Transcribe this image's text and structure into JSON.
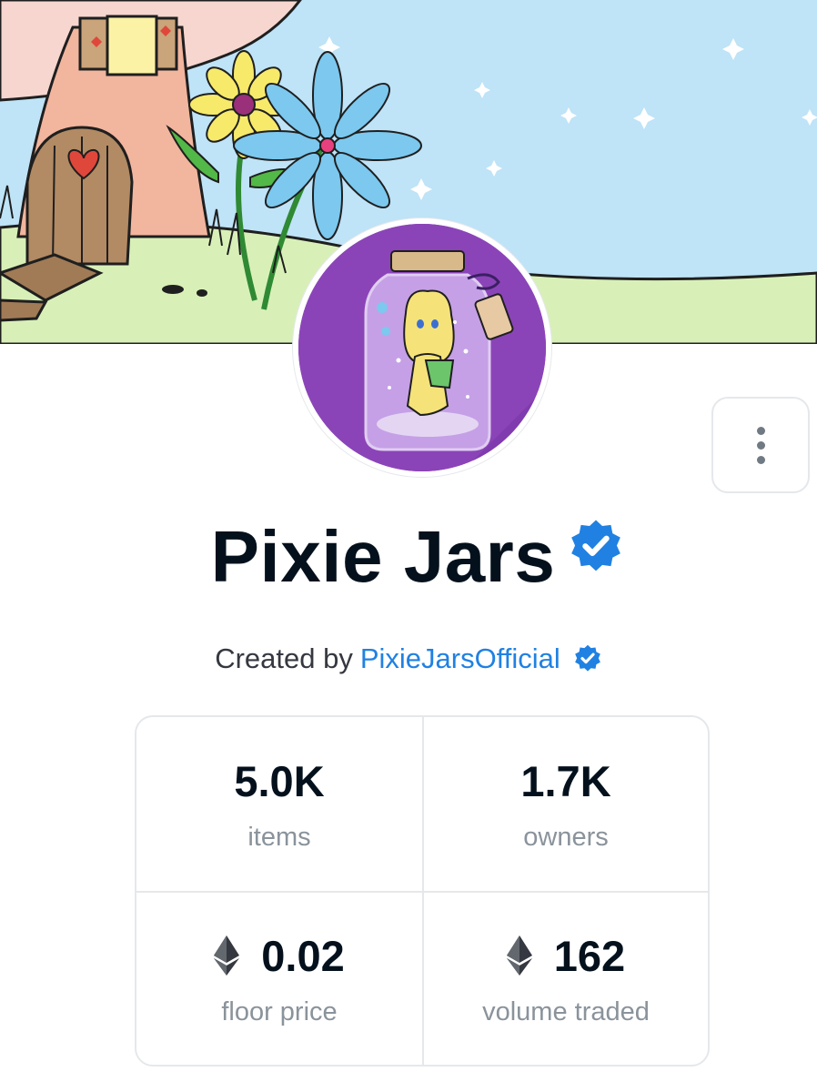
{
  "collection": {
    "name": "Pixie Jars",
    "created_by_prefix": "Created by",
    "creator": "PixieJarsOfficial"
  },
  "stats": [
    {
      "value": "5.0K",
      "label": "items",
      "eth": false
    },
    {
      "value": "1.7K",
      "label": "owners",
      "eth": false
    },
    {
      "value": "0.02",
      "label": "floor price",
      "eth": true
    },
    {
      "value": "162",
      "label": "volume traded",
      "eth": true
    }
  ],
  "colors": {
    "verified_badge": "#2081e2",
    "avatar_background": "#8b44b8",
    "sky": "#bfe3f7",
    "grass": "#d8f0b8"
  },
  "icons": {
    "verified": "verified-badge-icon",
    "more": "more-vertical-icon",
    "currency": "ethereum-icon"
  }
}
